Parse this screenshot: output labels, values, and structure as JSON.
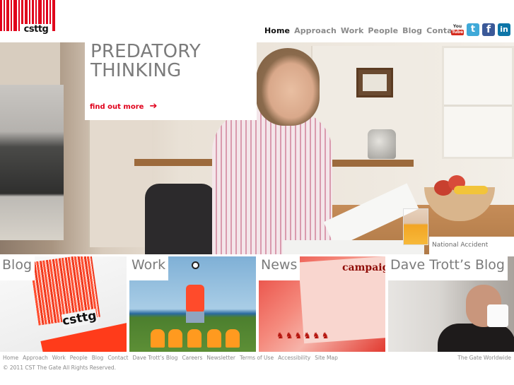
{
  "brand": {
    "logo_text": "csttg",
    "accent_color": "#e0001b"
  },
  "nav": {
    "items": [
      {
        "label": "Home",
        "active": true
      },
      {
        "label": "Approach",
        "active": false
      },
      {
        "label": "Work",
        "active": false
      },
      {
        "label": "People",
        "active": false
      },
      {
        "label": "Blog",
        "active": false
      },
      {
        "label": "Contact",
        "active": false
      }
    ]
  },
  "social": [
    {
      "name": "youtube-icon",
      "glyph_top": "You",
      "glyph_bottom": "Tube"
    },
    {
      "name": "twitter-icon",
      "glyph": "t"
    },
    {
      "name": "facebook-icon",
      "glyph": "f"
    },
    {
      "name": "linkedin-icon",
      "glyph": "in"
    }
  ],
  "hero": {
    "title_line1": "PREDATORY",
    "title_line2": "THINKING",
    "cta_label": "find out more",
    "cta_arrow": "➔",
    "caption": "National Accident Helpline"
  },
  "tiles": [
    {
      "label": "Blog",
      "image_text": "csttg"
    },
    {
      "label": "Work"
    },
    {
      "label": "News",
      "image_text": "campaign",
      "image_icons": "♞♞♞♞♞♞"
    },
    {
      "label": "Dave Trott’s Blog"
    }
  ],
  "footer": {
    "links": [
      "Home",
      "Approach",
      "Work",
      "People",
      "Blog",
      "Contact",
      "Dave Trott’s Blog",
      "Careers",
      "Newsletter",
      "Terms of Use",
      "Accessibility",
      "Site Map"
    ],
    "copyright": "© 2011 CST The Gate All Rights Reserved.",
    "right_link": "The Gate Worldwide"
  }
}
